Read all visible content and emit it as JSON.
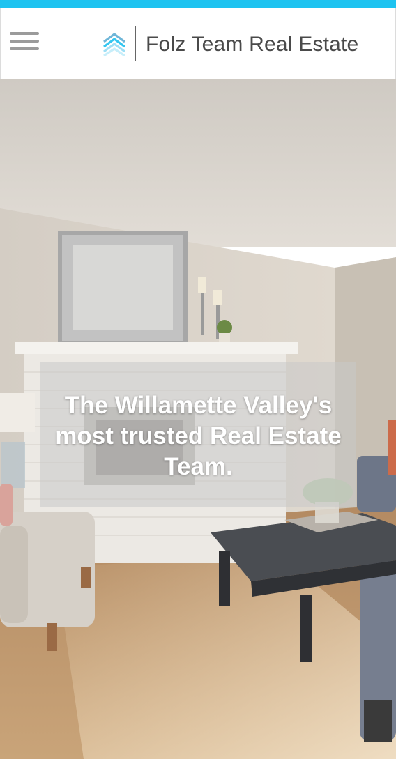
{
  "header": {
    "brand_name": "Folz Team Real Estate",
    "menu_icon": "hamburger-menu-icon",
    "logo_icon": "chevron-stack-logo-icon"
  },
  "hero": {
    "tagline": "The Willamette Valley's most trusted Real Estate Team."
  },
  "colors": {
    "accent": "#1ec3f0",
    "brand_text": "#4a4a4a",
    "menu_icon": "#9b9b9b"
  }
}
